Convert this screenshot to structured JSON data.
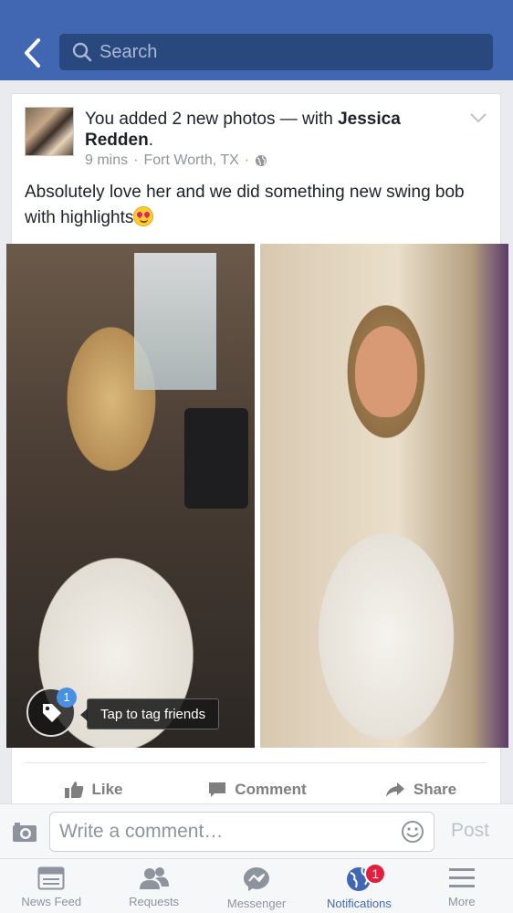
{
  "colors": {
    "nav_bg": "#4267b2",
    "search_bg": "#29487d",
    "accent": "#4267b2",
    "badge": "#e41e3f"
  },
  "header": {
    "search_placeholder": "Search",
    "back_icon": "chevron-left-icon",
    "search_icon": "search-icon"
  },
  "post": {
    "headline_pre": "You added 2 new photos — with ",
    "headline_person": "Jessica Redden",
    "headline_post": ".",
    "time": "9 mins",
    "location": "Fort Worth, TX",
    "separator": "·",
    "privacy_icon": "globe-icon",
    "text": "Absolutely love her and we did something new swing bob with highlights",
    "emoji": "heart-eyes-emoji",
    "tag_badge": "1",
    "tag_tooltip": "Tap to tag friends"
  },
  "actions": {
    "like": "Like",
    "comment": "Comment",
    "share": "Share"
  },
  "comment_bar": {
    "placeholder": "Write a comment…",
    "post": "Post"
  },
  "tabs": [
    {
      "label": "News Feed",
      "icon": "news-feed-icon"
    },
    {
      "label": "Requests",
      "icon": "friend-requests-icon"
    },
    {
      "label": "Messenger",
      "icon": "messenger-icon"
    },
    {
      "label": "Notifications",
      "icon": "globe-icon",
      "badge": "1"
    },
    {
      "label": "More",
      "icon": "hamburger-menu-icon"
    }
  ]
}
